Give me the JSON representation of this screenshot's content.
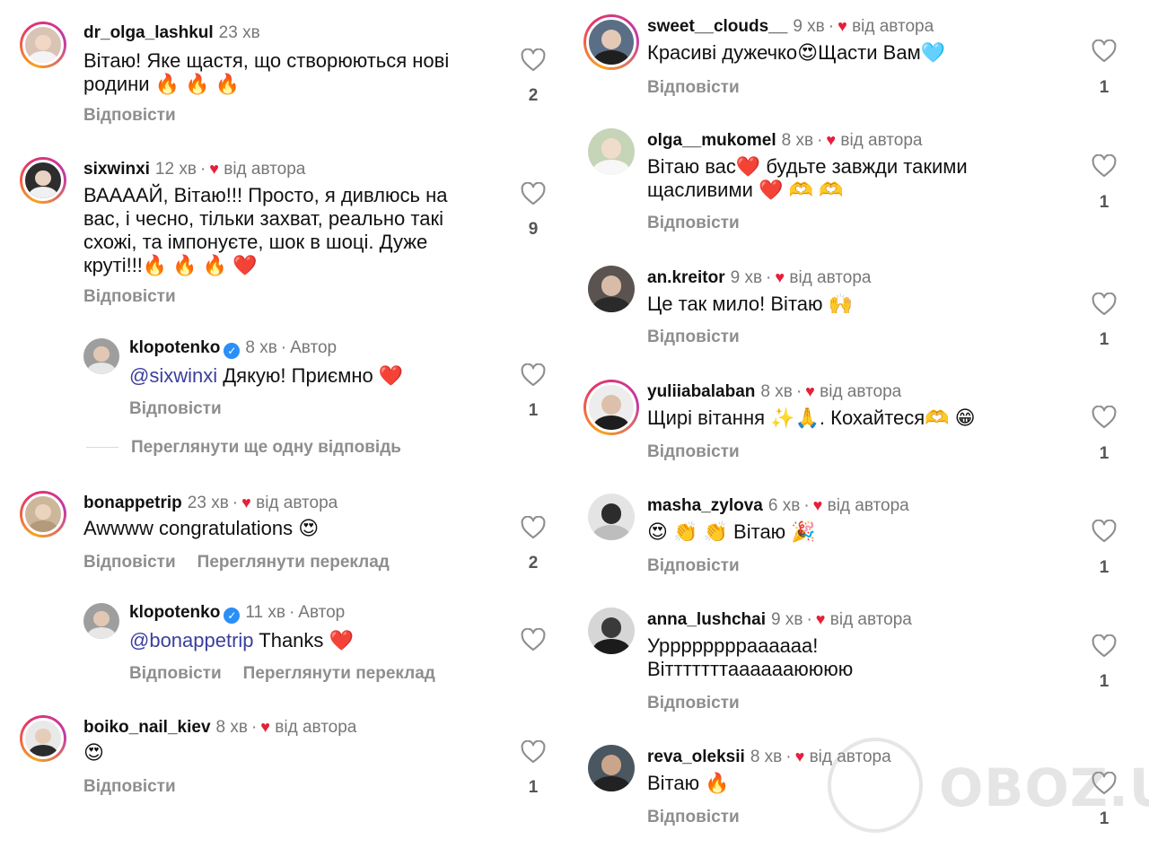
{
  "reply_label": "Відповісти",
  "translate_label": "Переглянути переклад",
  "by_author_label": "від автора",
  "author_label": "Автор",
  "more_replies_label": "Переглянути ще одну відповідь",
  "watermark": "OBOZ.UA",
  "colors": {
    "heart": "#e5203a",
    "verified": "#2a8ff7",
    "mention": "#3b3f9e",
    "muted": "#8e8e8e"
  },
  "left_column": [
    {
      "username": "dr_olga_lashkul",
      "time": "23 хв",
      "liked_by_author": false,
      "text_lines": [
        "Вітаю! Яке щастя, що створюються нові",
        "родини 🔥 🔥 🔥"
      ],
      "likes": "2"
    },
    {
      "username": "sixwinxi",
      "time": "12 хв",
      "liked_by_author": true,
      "text_lines": [
        "ВААААЙ, Вітаю!!! Просто, я дивлюсь на",
        "вас, і чесно, тільки захват, реально такі",
        "схожі, та імпонуєте, шок в шоці. Дуже",
        "круті!!!🔥 🔥 🔥 ❤️"
      ],
      "likes": "9"
    },
    {
      "username": "klopotenko",
      "time": "8 хв",
      "is_author": true,
      "mention": "@sixwinxi",
      "text": "Дякую! Приємно ❤️",
      "likes": "1"
    },
    {
      "username": "bonappetrip",
      "time": "23 хв",
      "liked_by_author": true,
      "text": "Awwww congratulations 😍",
      "likes": "2"
    },
    {
      "username": "klopotenko",
      "time": "11 хв",
      "is_author": true,
      "mention": "@bonappetrip",
      "text": "Thanks ❤️",
      "likes": ""
    },
    {
      "username": "boiko_nail_kiev",
      "time": "8 хв",
      "liked_by_author": true,
      "text": "😍",
      "likes": "1"
    }
  ],
  "right_column": [
    {
      "username": "sweet__clouds__",
      "time": "9 хв",
      "liked_by_author": true,
      "text_lines": [
        "Красиві дужечко😍Щасти Вам🩵"
      ],
      "likes": "1"
    },
    {
      "username": "olga__mukomel",
      "time": "8 хв",
      "liked_by_author": true,
      "text_lines": [
        "Вітаю вас❤️ будьте завжди такими",
        "щасливими ❤️ 🫶 🫶"
      ],
      "likes": "1"
    },
    {
      "username": "an.kreitor",
      "time": "9 хв",
      "liked_by_author": true,
      "text_lines": [
        "Це так мило! Вітаю 🙌"
      ],
      "likes": "1"
    },
    {
      "username": "yuliiabalaban",
      "time": "8 хв",
      "liked_by_author": true,
      "text_lines": [
        "Щирі вітання ✨🙏. Кохайтеся🫶 😁"
      ],
      "likes": "1"
    },
    {
      "username": "masha_zylova",
      "time": "6 хв",
      "liked_by_author": true,
      "text_lines": [
        "😍 👏 👏 Вітаю 🎉"
      ],
      "likes": "1"
    },
    {
      "username": "anna_lushchai",
      "time": "9 хв",
      "liked_by_author": true,
      "text_lines": [
        "Урррррррраааааа!",
        "Вітттттттааааааюююю"
      ],
      "likes": "1"
    },
    {
      "username": "reva_oleksii",
      "time": "8 хв",
      "liked_by_author": true,
      "text_lines": [
        "Вітаю 🔥"
      ],
      "likes": "1"
    }
  ]
}
